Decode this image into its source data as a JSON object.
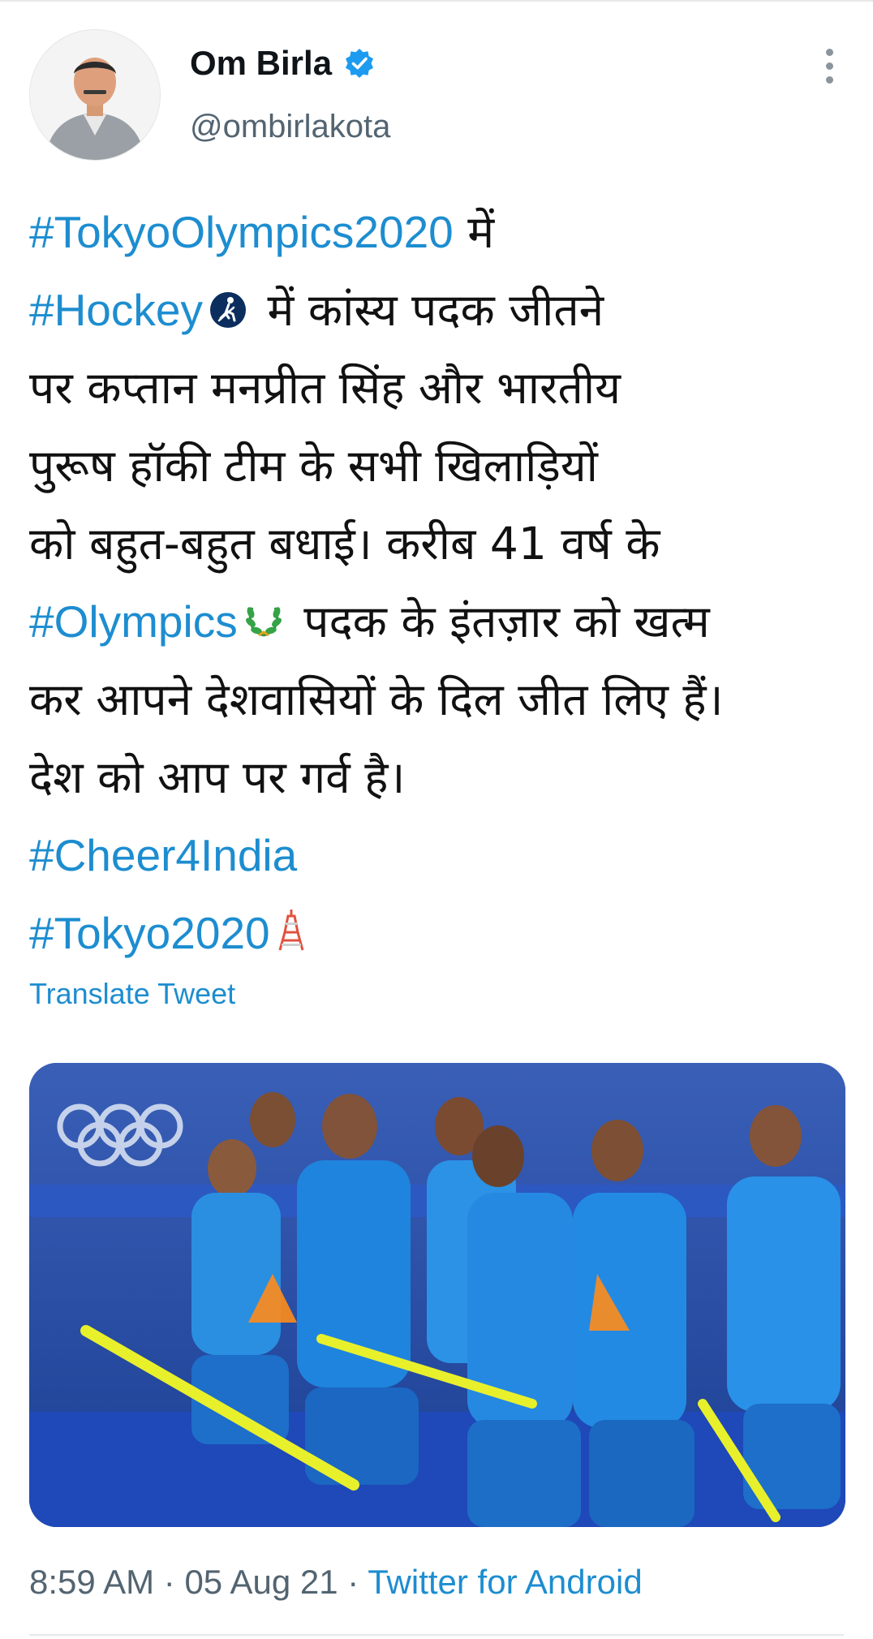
{
  "author": {
    "name": "Om Birla",
    "handle": "@ombirlakota",
    "verified": true
  },
  "tweet": {
    "lines": [
      [
        {
          "tag": "#TokyoOlympics2020"
        },
        {
          "text": " में"
        }
      ],
      [
        {
          "tag": "#Hockey"
        },
        {
          "emoji": "field-hockey-icon"
        },
        {
          "text": " में कांस्य पदक जीतने"
        }
      ],
      [
        {
          "text": "पर कप्तान मनप्रीत सिंह और भारतीय"
        }
      ],
      [
        {
          "text": "पुरूष हॉकी टीम के सभी खिलाड़ियों"
        }
      ],
      [
        {
          "text": "को बहुत-बहुत बधाई। करीब 41 वर्ष के"
        }
      ],
      [
        {
          "tag": "#Olympics"
        },
        {
          "emoji": "laurel-wreath-icon"
        },
        {
          "text": " पदक के इंतज़ार को खत्म"
        }
      ],
      [
        {
          "text": "कर आपने देशवासियों के दिल जीत लिए हैं।"
        }
      ],
      [
        {
          "text": "देश को आप पर गर्व है।"
        }
      ],
      [
        {
          "tag": "#Cheer4India"
        }
      ],
      [
        {
          "tag": "#Tokyo2020"
        },
        {
          "emoji": "tokyo-tower-icon"
        }
      ]
    ],
    "translate_label": "Translate Tweet"
  },
  "media": {
    "icon": "team-photo-image"
  },
  "meta": {
    "time": "8:59 AM",
    "separator": " · ",
    "date": "05 Aug 21",
    "source": "Twitter for Android"
  },
  "colors": {
    "link": "#1d8dd0",
    "text": "#111111",
    "muted": "#536471",
    "verified": "#1d9bf0"
  }
}
